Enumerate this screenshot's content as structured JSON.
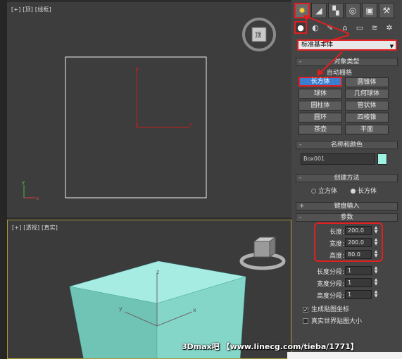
{
  "viewports": {
    "top_label": "[+] [顶] [线框]",
    "persp_label": "[+] [透视] [真实]",
    "viewcube_top_face": "顶"
  },
  "panel": {
    "tabs": [
      "create-icon",
      "modify-icon",
      "hierarchy-icon",
      "motion-icon",
      "display-icon",
      "utilities-icon"
    ],
    "dropdown_value": "标准基本体",
    "object_type": {
      "title": "对象类型",
      "autogrid": "自动栅格",
      "buttons": [
        "长方体",
        "圆锥体",
        "球体",
        "几何球体",
        "圆柱体",
        "管状体",
        "圆环",
        "四棱锥",
        "茶壶",
        "平面"
      ]
    },
    "name_color": {
      "title": "名称和颜色",
      "name": "Box001",
      "color": "#9ef2e4"
    },
    "creation_method": {
      "title": "创建方法",
      "opt_cube": "立方体",
      "opt_box": "长方体"
    },
    "keyboard_entry": {
      "title": "键盘输入"
    },
    "params": {
      "title": "参数",
      "length_label": "长度:",
      "length": "200.0",
      "width_label": "宽度:",
      "width": "200.0",
      "height_label": "高度:",
      "height": "80.0",
      "lseg_label": "长度分段:",
      "lseg": "1",
      "wseg_label": "宽度分段:",
      "wseg": "1",
      "hseg_label": "高度分段:",
      "hseg": "1",
      "gen_map": "生成贴图坐标",
      "real_world": "真实世界贴图大小"
    }
  },
  "watermark": "3Dmax吧 【www.linecg.com/tieba/1771】",
  "accent_red": "#e02020",
  "box_color": "#80d8c8"
}
